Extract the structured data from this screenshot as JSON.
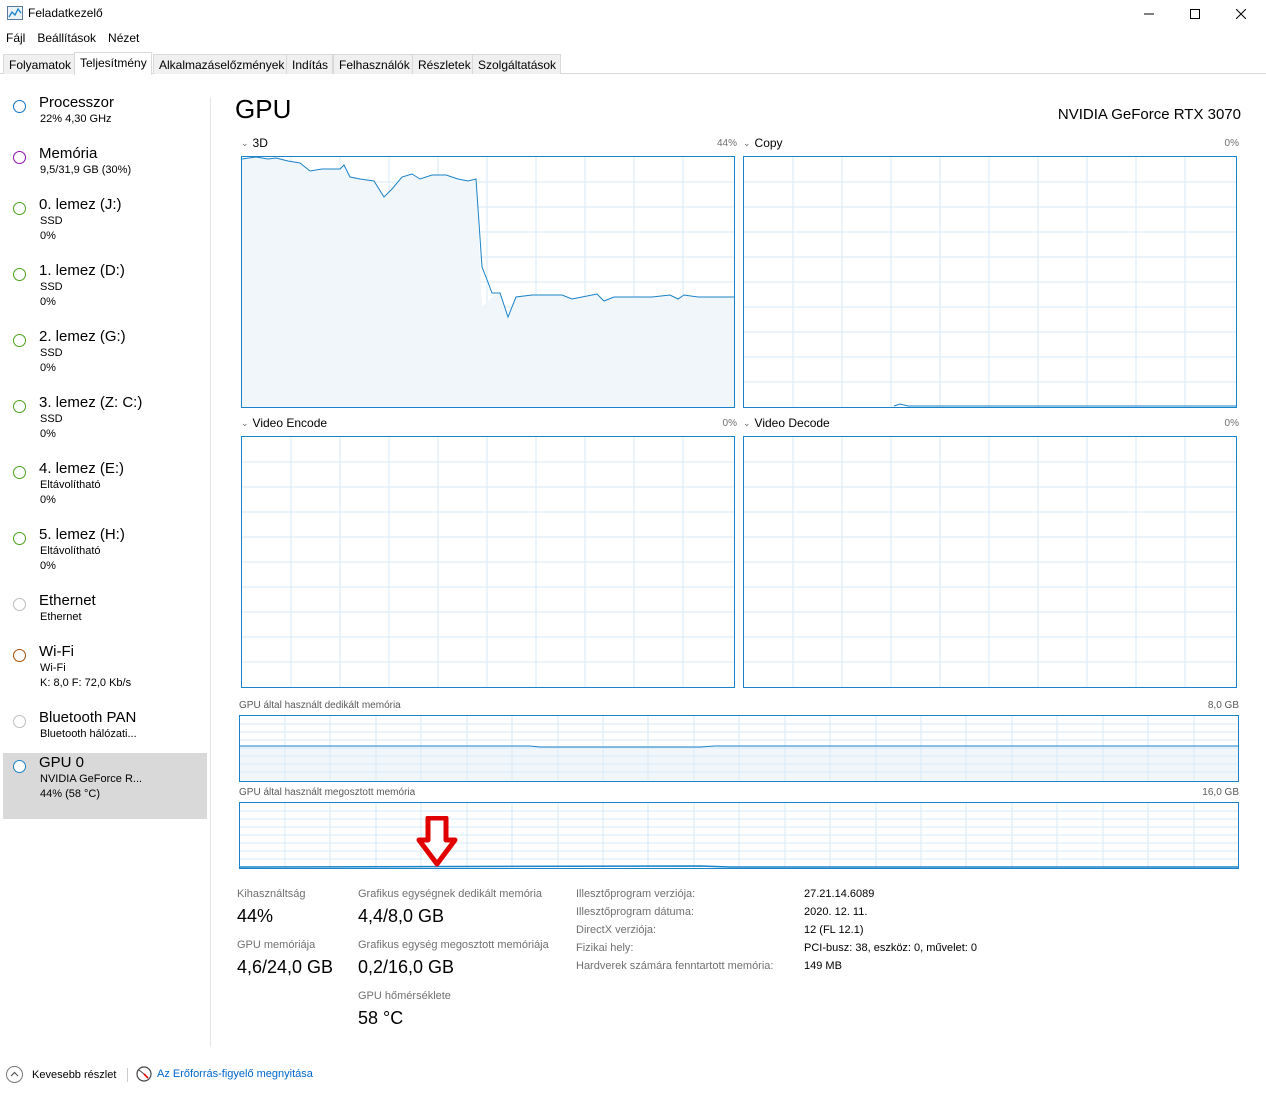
{
  "window": {
    "title": "Feladatkezelő"
  },
  "menu": [
    "Fájl",
    "Beállítások",
    "Nézet"
  ],
  "tabs": [
    "Folyamatok",
    "Teljesítmény",
    "Alkalmazáselőzmények",
    "Indítás",
    "Felhasználók",
    "Részletek",
    "Szolgáltatások"
  ],
  "active_tab": "Teljesítmény",
  "sidebar": [
    {
      "title": "Processzor",
      "sub1": "22%  4,30 GHz",
      "sub2": "",
      "color": "#1173c6"
    },
    {
      "title": "Memória",
      "sub1": "9,5/31,9 GB (30%)",
      "sub2": "",
      "color": "#8b12ae"
    },
    {
      "title": "0. lemez (J:)",
      "sub1": "SSD",
      "sub2": "0%",
      "color": "#4ba21a"
    },
    {
      "title": "1. lemez (D:)",
      "sub1": "SSD",
      "sub2": "0%",
      "color": "#4ba21a"
    },
    {
      "title": "2. lemez (G:)",
      "sub1": "SSD",
      "sub2": "0%",
      "color": "#4ba21a"
    },
    {
      "title": "3. lemez (Z: C:)",
      "sub1": "SSD",
      "sub2": "0%",
      "color": "#4ba21a"
    },
    {
      "title": "4. lemez (E:)",
      "sub1": "Eltávolítható",
      "sub2": "0%",
      "color": "#4ba21a"
    },
    {
      "title": "5. lemez (H:)",
      "sub1": "Eltávolítható",
      "sub2": "0%",
      "color": "#4ba21a"
    },
    {
      "title": "Ethernet",
      "sub1": "Ethernet",
      "sub2": "",
      "color": "#bdbdbd"
    },
    {
      "title": "Wi-Fi",
      "sub1": "Wi-Fi",
      "sub2": "K: 8,0  F: 72,0 Kb/s",
      "color": "#a74f01"
    },
    {
      "title": "Bluetooth PAN",
      "sub1": "Bluetooth hálózati...",
      "sub2": "",
      "color": "#bdbdbd"
    },
    {
      "title": "GPU 0",
      "sub1": "NVIDIA GeForce R...",
      "sub2": "44% (58 °C)",
      "color": "#1982c8"
    }
  ],
  "main": {
    "title": "GPU",
    "device_name": "NVIDIA GeForce RTX 3070",
    "graphs": [
      {
        "label": "3D",
        "pct": "44%"
      },
      {
        "label": "Copy",
        "pct": "0%"
      },
      {
        "label": "Video Encode",
        "pct": "0%"
      },
      {
        "label": "Video Decode",
        "pct": "0%"
      }
    ],
    "dedicated_memory": {
      "label": "GPU által használt dedikált memória",
      "max": "8,0 GB"
    },
    "shared_memory": {
      "label": "GPU által használt megosztott memória",
      "max": "16,0 GB"
    }
  },
  "stats": {
    "utilization_label": "Kihasználtság",
    "utilization_value": "44%",
    "gpu_memory_label": "GPU memóriája",
    "gpu_memory_value": "4,6/24,0 GB",
    "dedicated_label": "Grafikus egységnek dedikált memória",
    "dedicated_value": "4,4/8,0 GB",
    "shared_label": "Grafikus egység megosztott memóriája",
    "shared_value": "0,2/16,0 GB",
    "temp_label": "GPU hőmérséklete",
    "temp_value": "58 °C"
  },
  "info": [
    {
      "label": "Illesztőprogram verziója:",
      "value": "27.21.14.6089"
    },
    {
      "label": "Illesztőprogram dátuma:",
      "value": "2020. 12. 11."
    },
    {
      "label": "DirectX verziója:",
      "value": "12 (FL 12.1)"
    },
    {
      "label": "Fizikai hely:",
      "value": "PCI-busz: 38, eszköz: 0, művelet: 0"
    },
    {
      "label": "Hardverek számára fenntartott memória:",
      "value": "149 MB"
    }
  ],
  "footer": {
    "fewer_details": "Kevesebb részlet",
    "resource_monitor": "Az Erőforrás-figyelő megnyitása"
  },
  "accent_color": "#1982c8",
  "graph_fill_color": "#f1f6fa",
  "arrow_color": "#e00000"
}
